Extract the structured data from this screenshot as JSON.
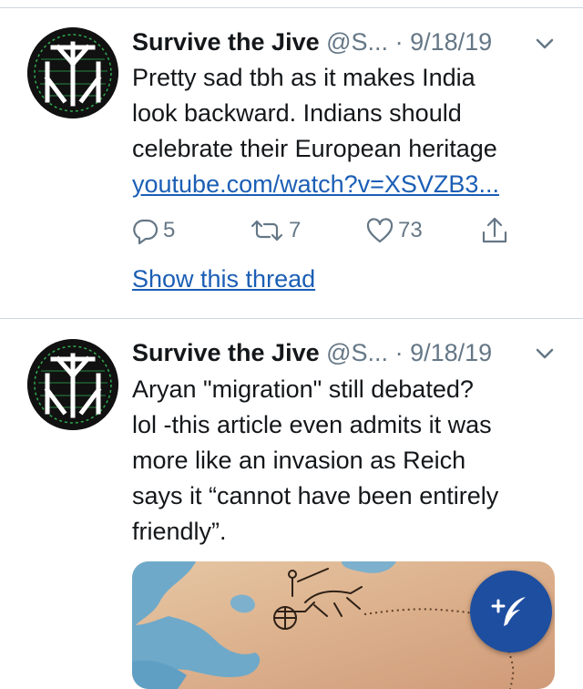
{
  "tweets": [
    {
      "author_name": "Survive the Jive",
      "handle": "@S...",
      "separator": "·",
      "date": "9/18/19",
      "text_lines": [
        "Pretty sad tbh as it makes India",
        "look backward. Indians should",
        "celebrate their European heritage"
      ],
      "link_text": "youtube.com/watch?v=XSVZB3...",
      "replies": "5",
      "retweets": "7",
      "likes": "73",
      "thread_link": "Show this thread"
    },
    {
      "author_name": "Survive the Jive",
      "handle": "@S...",
      "separator": "·",
      "date": "9/18/19",
      "text_lines": [
        "Aryan \"migration\" still debated?",
        "lol -this article even admits it was",
        "more like an invasion as Reich",
        "says it “cannot have been entirely",
        "friendly”."
      ]
    }
  ],
  "icons": {
    "avatar": "rune-logo-icon",
    "chevron": "chevron-down-icon",
    "reply": "reply-icon",
    "retweet": "retweet-icon",
    "like": "heart-icon",
    "share": "share-icon",
    "compose": "compose-tweet-icon"
  },
  "colors": {
    "link": "#1b5eb5",
    "meta": "#657786",
    "fab": "#1e4ea0",
    "divider": "#cfd7de"
  }
}
